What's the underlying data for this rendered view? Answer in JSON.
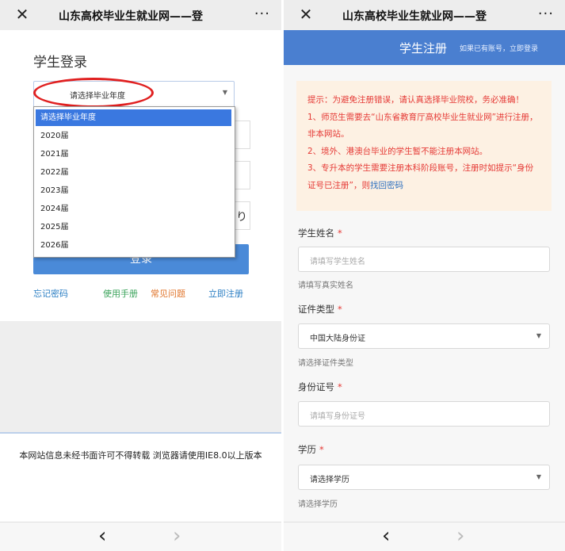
{
  "left": {
    "navbar": {
      "close_icon": "✕",
      "title": "山东高校毕业生就业网——登",
      "more_icon": "···"
    },
    "login_title": "学生登录",
    "grade_select": {
      "selected": "请选择毕业年度",
      "arrow": "▼",
      "options": [
        "请选择毕业年度",
        "2020届",
        "2021届",
        "2022届",
        "2023届",
        "2024届",
        "2025届",
        "2026届"
      ]
    },
    "partial_icon": "り",
    "login_button": "登录",
    "links": {
      "forgot": "忘记密码",
      "manual": "使用手册",
      "faq": "常见问题",
      "register": "立即注册"
    },
    "footer": "本网站信息未经书面许可不得转载 浏览器请使用IE8.0以上版本",
    "bottom_nav": {
      "back": "‹",
      "forward": "›"
    }
  },
  "right": {
    "navbar": {
      "close_icon": "✕",
      "title": "山东高校毕业生就业网——登",
      "more_icon": "···"
    },
    "header": {
      "title": "学生注册",
      "subtitle": "如果已有账号，立即登录"
    },
    "notice": {
      "line1": "提示：为避免注册错误，请认真选择毕业院校，务必准确！",
      "line2": "1、师范生需要去“山东省教育厅高校毕业生就业网”进行注册，非本网站。",
      "line3": "2、境外、港澳台毕业的学生暂不能注册本网站。",
      "line4_prefix": "3、专升本的学生需要注册本科阶段账号，注册时如提示“身份证号已注册”，则",
      "line4_link": "找回密码"
    },
    "form": {
      "name_label": "学生姓名",
      "name_placeholder": "请填写学生姓名",
      "name_hint": "请填写真实姓名",
      "idtype_label": "证件类型",
      "idtype_value": "中国大陆身份证",
      "idtype_hint": "请选择证件类型",
      "idno_label": "身份证号",
      "idno_placeholder": "请填写身份证号",
      "edu_label": "学历",
      "edu_value": "请选择学历",
      "edu_hint": "请选择学历",
      "required_mark": "*",
      "arrow": "▼"
    },
    "bottom_nav": {
      "back": "‹",
      "forward": "›"
    }
  },
  "colors": {
    "accent_blue": "#4a7fd0",
    "selected_option": "#3a78e0",
    "notice_red": "#e53935",
    "annotation_red": "#e02020"
  }
}
